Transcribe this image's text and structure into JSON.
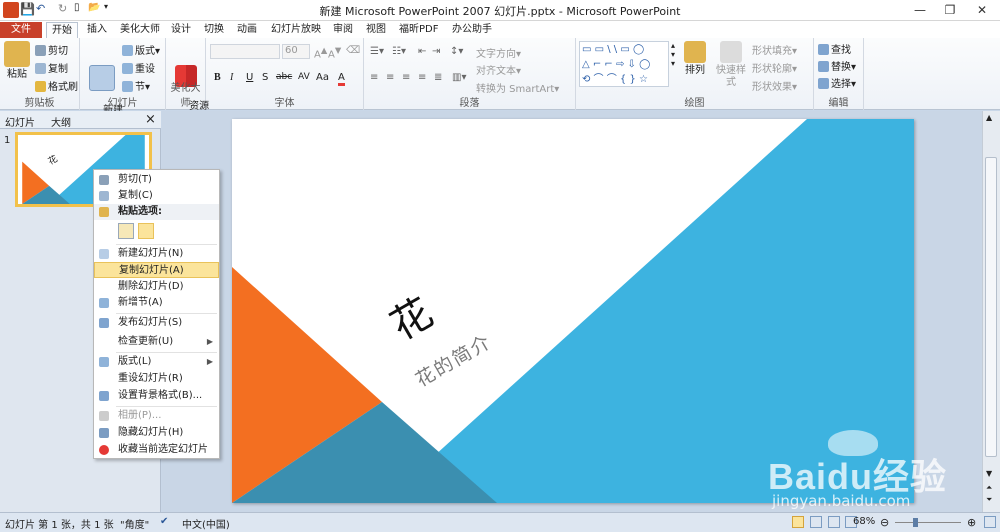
{
  "window": {
    "title": "新建 Microsoft PowerPoint 2007 幻灯片.pptx - Microsoft PowerPoint"
  },
  "tabs": [
    "文件",
    "开始",
    "插入",
    "美化大师",
    "设计",
    "切换",
    "动画",
    "幻灯片放映",
    "审阅",
    "视图",
    "福昕PDF",
    "办公助手"
  ],
  "ribbon": {
    "clipboard": {
      "label": "剪贴板",
      "paste": "粘贴",
      "cut": "剪切",
      "copy": "复制",
      "format_painter": "格式刷"
    },
    "slides": {
      "label": "幻灯片",
      "new_slide": "新建\n幻灯片▾",
      "layout": "版式▾",
      "reset": "重设",
      "section": "节▾"
    },
    "beautify": {
      "label": "美化大师",
      "resource_square": "资源\n广场"
    },
    "font": {
      "label": "字体",
      "size": "60",
      "bold": "B",
      "italic": "I",
      "underline": "U",
      "strike": "S",
      "shadow": "abc",
      "spacing": "AV",
      "case": "Aa",
      "color": "A"
    },
    "paragraph": {
      "label": "段落",
      "text_direction": "文字方向▾",
      "align_text": "对齐文本▾",
      "smartart": "转换为 SmartArt▾"
    },
    "drawing": {
      "label": "绘图",
      "arrange": "排列",
      "quick_styles": "快速样式",
      "shape_fill": "形状填充▾",
      "shape_outline": "形状轮廓▾",
      "shape_effects": "形状效果▾"
    },
    "editing": {
      "label": "编辑",
      "find": "查找",
      "replace": "替换▾",
      "select": "选择▾"
    }
  },
  "left_pane": {
    "tab_slides": "幻灯片",
    "tab_outline": "大纲",
    "close": "×",
    "slide_number": "1",
    "thumb_title": "花"
  },
  "context_menu": {
    "items": [
      {
        "label": "剪切(T)",
        "enabled": true
      },
      {
        "label": "复制(C)",
        "enabled": true
      },
      {
        "label": "粘贴选项:",
        "enabled": true
      },
      {
        "label": "新建幻灯片(N)",
        "enabled": true
      },
      {
        "label": "复制幻灯片(A)",
        "enabled": true,
        "highlighted": true
      },
      {
        "label": "删除幻灯片(D)",
        "enabled": true
      },
      {
        "label": "新增节(A)",
        "enabled": true
      },
      {
        "label": "发布幻灯片(S)",
        "enabled": true
      },
      {
        "label": "检查更新(U)",
        "enabled": true
      },
      {
        "label": "版式(L)",
        "enabled": true
      },
      {
        "label": "重设幻灯片(R)",
        "enabled": true
      },
      {
        "label": "设置背景格式(B)...",
        "enabled": true
      },
      {
        "label": "相册(P)...",
        "enabled": false
      },
      {
        "label": "隐藏幻灯片(H)",
        "enabled": true
      },
      {
        "label": "收藏当前选定幻灯片",
        "enabled": true
      }
    ]
  },
  "slide": {
    "title": "花",
    "subtitle": "花的简介",
    "colors": {
      "blue": "#3db3e0",
      "orange": "#f36f21",
      "dark": "#3b8fb0"
    }
  },
  "status": {
    "slide_info": "幻灯片 第 1 张，共 1 张",
    "theme": "\"角度\"",
    "language": "中文(中国)",
    "zoom": "68%"
  },
  "watermark": {
    "brand": "Baidu经验",
    "url": "jingyan.baidu.com"
  }
}
